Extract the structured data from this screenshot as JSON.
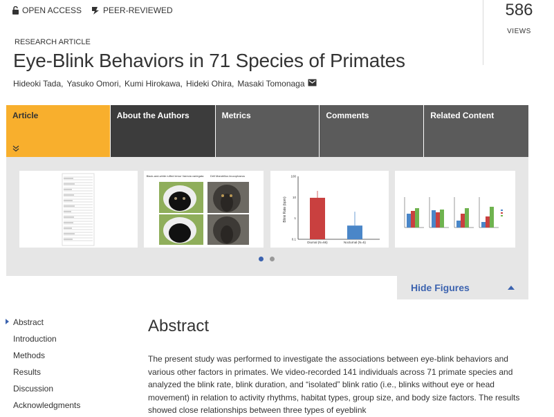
{
  "badges": {
    "open_access": "OPEN ACCESS",
    "peer_reviewed": "PEER-REVIEWED"
  },
  "views": {
    "count": "586",
    "label": "VIEWS"
  },
  "article": {
    "type_label": "RESEARCH ARTICLE",
    "title": "Eye-Blink Behaviors in 71 Species of Primates",
    "authors": [
      "Hideoki Tada,",
      "Yasuko Omori,",
      "Kumi Hirokawa,",
      "Hideki Ohira,",
      "Masaki Tomonaga"
    ]
  },
  "tabs": [
    "Article",
    "About the Authors",
    "Metrics",
    "Comments",
    "Related Content"
  ],
  "figures": {
    "hide_label": "Hide Figures",
    "photo_labels": {
      "left": "Black-and-white ruffed lemur Varecia variegata",
      "right": "Drill Mandrillus leucophaeus"
    },
    "blink_chart": {
      "ylabel": "Blink Rate (bpm)",
      "ticks": [
        "100",
        "10",
        "1",
        "0.1"
      ],
      "categories": [
        "Diurnal (N=66)",
        "Nocturnal (N=5)"
      ],
      "values": [
        9.5,
        0.45
      ],
      "colors": [
        "#c9403f",
        "#4a86c8"
      ]
    }
  },
  "toc": [
    "Abstract",
    "Introduction",
    "Methods",
    "Results",
    "Discussion",
    "Acknowledgments"
  ],
  "abstract": {
    "heading": "Abstract",
    "text": "The present study was performed to investigate the associations between eye-blink behaviors and various other factors in primates. We video-recorded 141 individuals across 71 primate species and analyzed the blink rate, blink duration, and “isolated” blink ratio (i.e., blinks without eye or head movement) in relation to activity rhythms, habitat types, group size, and body size factors. The results showed close relationships between three types of eyeblink"
  }
}
